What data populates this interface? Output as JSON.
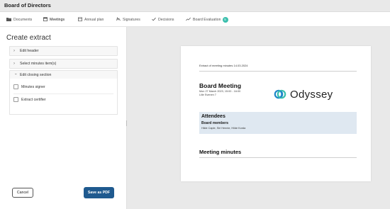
{
  "window": {
    "title": "Board of Directors"
  },
  "tabs": [
    {
      "label": "Documents",
      "icon": "folder-icon"
    },
    {
      "label": "Meetings",
      "icon": "calendar-icon",
      "active": true
    },
    {
      "label": "Annual plan",
      "icon": "calendar-grid-icon"
    },
    {
      "label": "Signatures",
      "icon": "signature-icon"
    },
    {
      "label": "Decisions",
      "icon": "check-icon"
    },
    {
      "label": "Board Evaluation",
      "icon": "trend-icon",
      "badge": "5"
    }
  ],
  "panel": {
    "title": "Create extract",
    "sections": [
      {
        "label": "Edit header",
        "expanded": false
      },
      {
        "label": "Select minutes item(s)",
        "expanded": false
      },
      {
        "label": "Edit closing section",
        "expanded": true
      }
    ],
    "closing_options": [
      {
        "label": "Minutes signer",
        "checked": false
      },
      {
        "label": "Extract certifier",
        "checked": false
      }
    ],
    "cancel_label": "Cancel",
    "save_label": "Save as PDF"
  },
  "preview": {
    "extract_line": "Extract of meeting minutes 14.03.2024",
    "meeting_title": "Board Meeting",
    "meeting_date": "Mon 27 March 2023, 15:00 - 16:00",
    "location": "Lille Svenen 7",
    "logo_text": "Odyssey",
    "attendees_title": "Attendees",
    "board_members_title": "Board members",
    "board_members_names": "Hilde Caple, Siri Hennie, Hilde Korda",
    "minutes_title": "Meeting minutes"
  },
  "colors": {
    "accent": "#2aa198",
    "primary_button": "#1f5a8f",
    "badge": "#3bbfad",
    "attendees_bg": "#dfe8f1"
  }
}
